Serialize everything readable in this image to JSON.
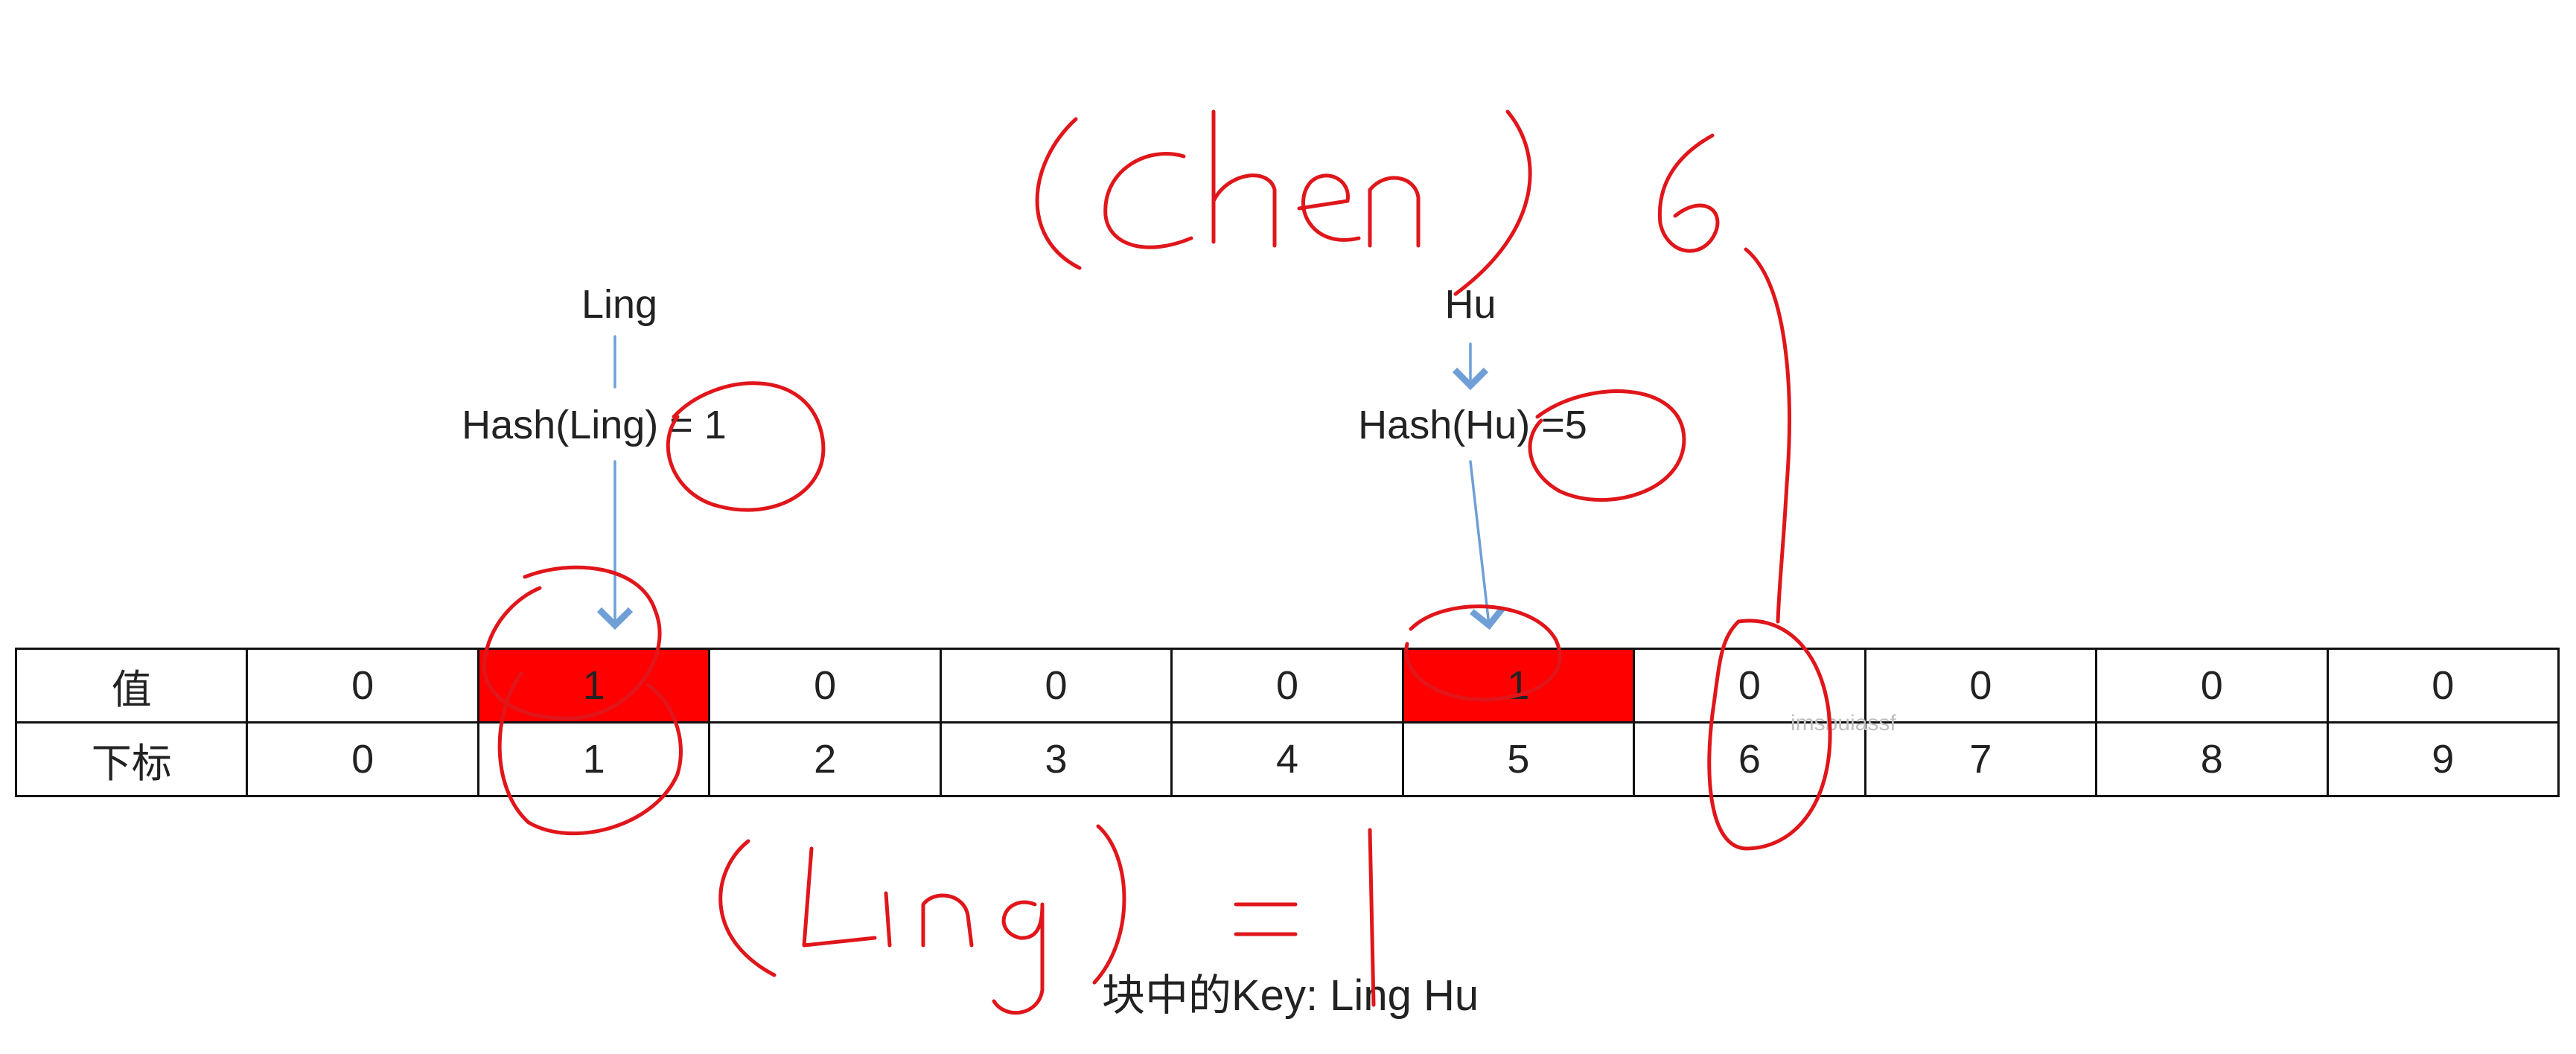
{
  "top_labels": {
    "left_key": "Ling",
    "left_hash": "Hash(Ling) = 1",
    "right_key": "Hu",
    "right_hash": "Hash(Hu) =5"
  },
  "table": {
    "row_headers": [
      "值",
      "下标"
    ],
    "values": [
      "0",
      "1",
      "0",
      "0",
      "0",
      "1",
      "0",
      "0",
      "0",
      "0"
    ],
    "indices": [
      "0",
      "1",
      "2",
      "3",
      "4",
      "5",
      "6",
      "7",
      "8",
      "9"
    ],
    "highlight_color": "#ff0000"
  },
  "caption": "块中的Key: Ling Hu",
  "watermark": "imsbuiassf",
  "handwriting": {
    "top": "( Chen ) 6",
    "bottom": "( Ling ) = 1",
    "ink_color": "#e0161b"
  }
}
